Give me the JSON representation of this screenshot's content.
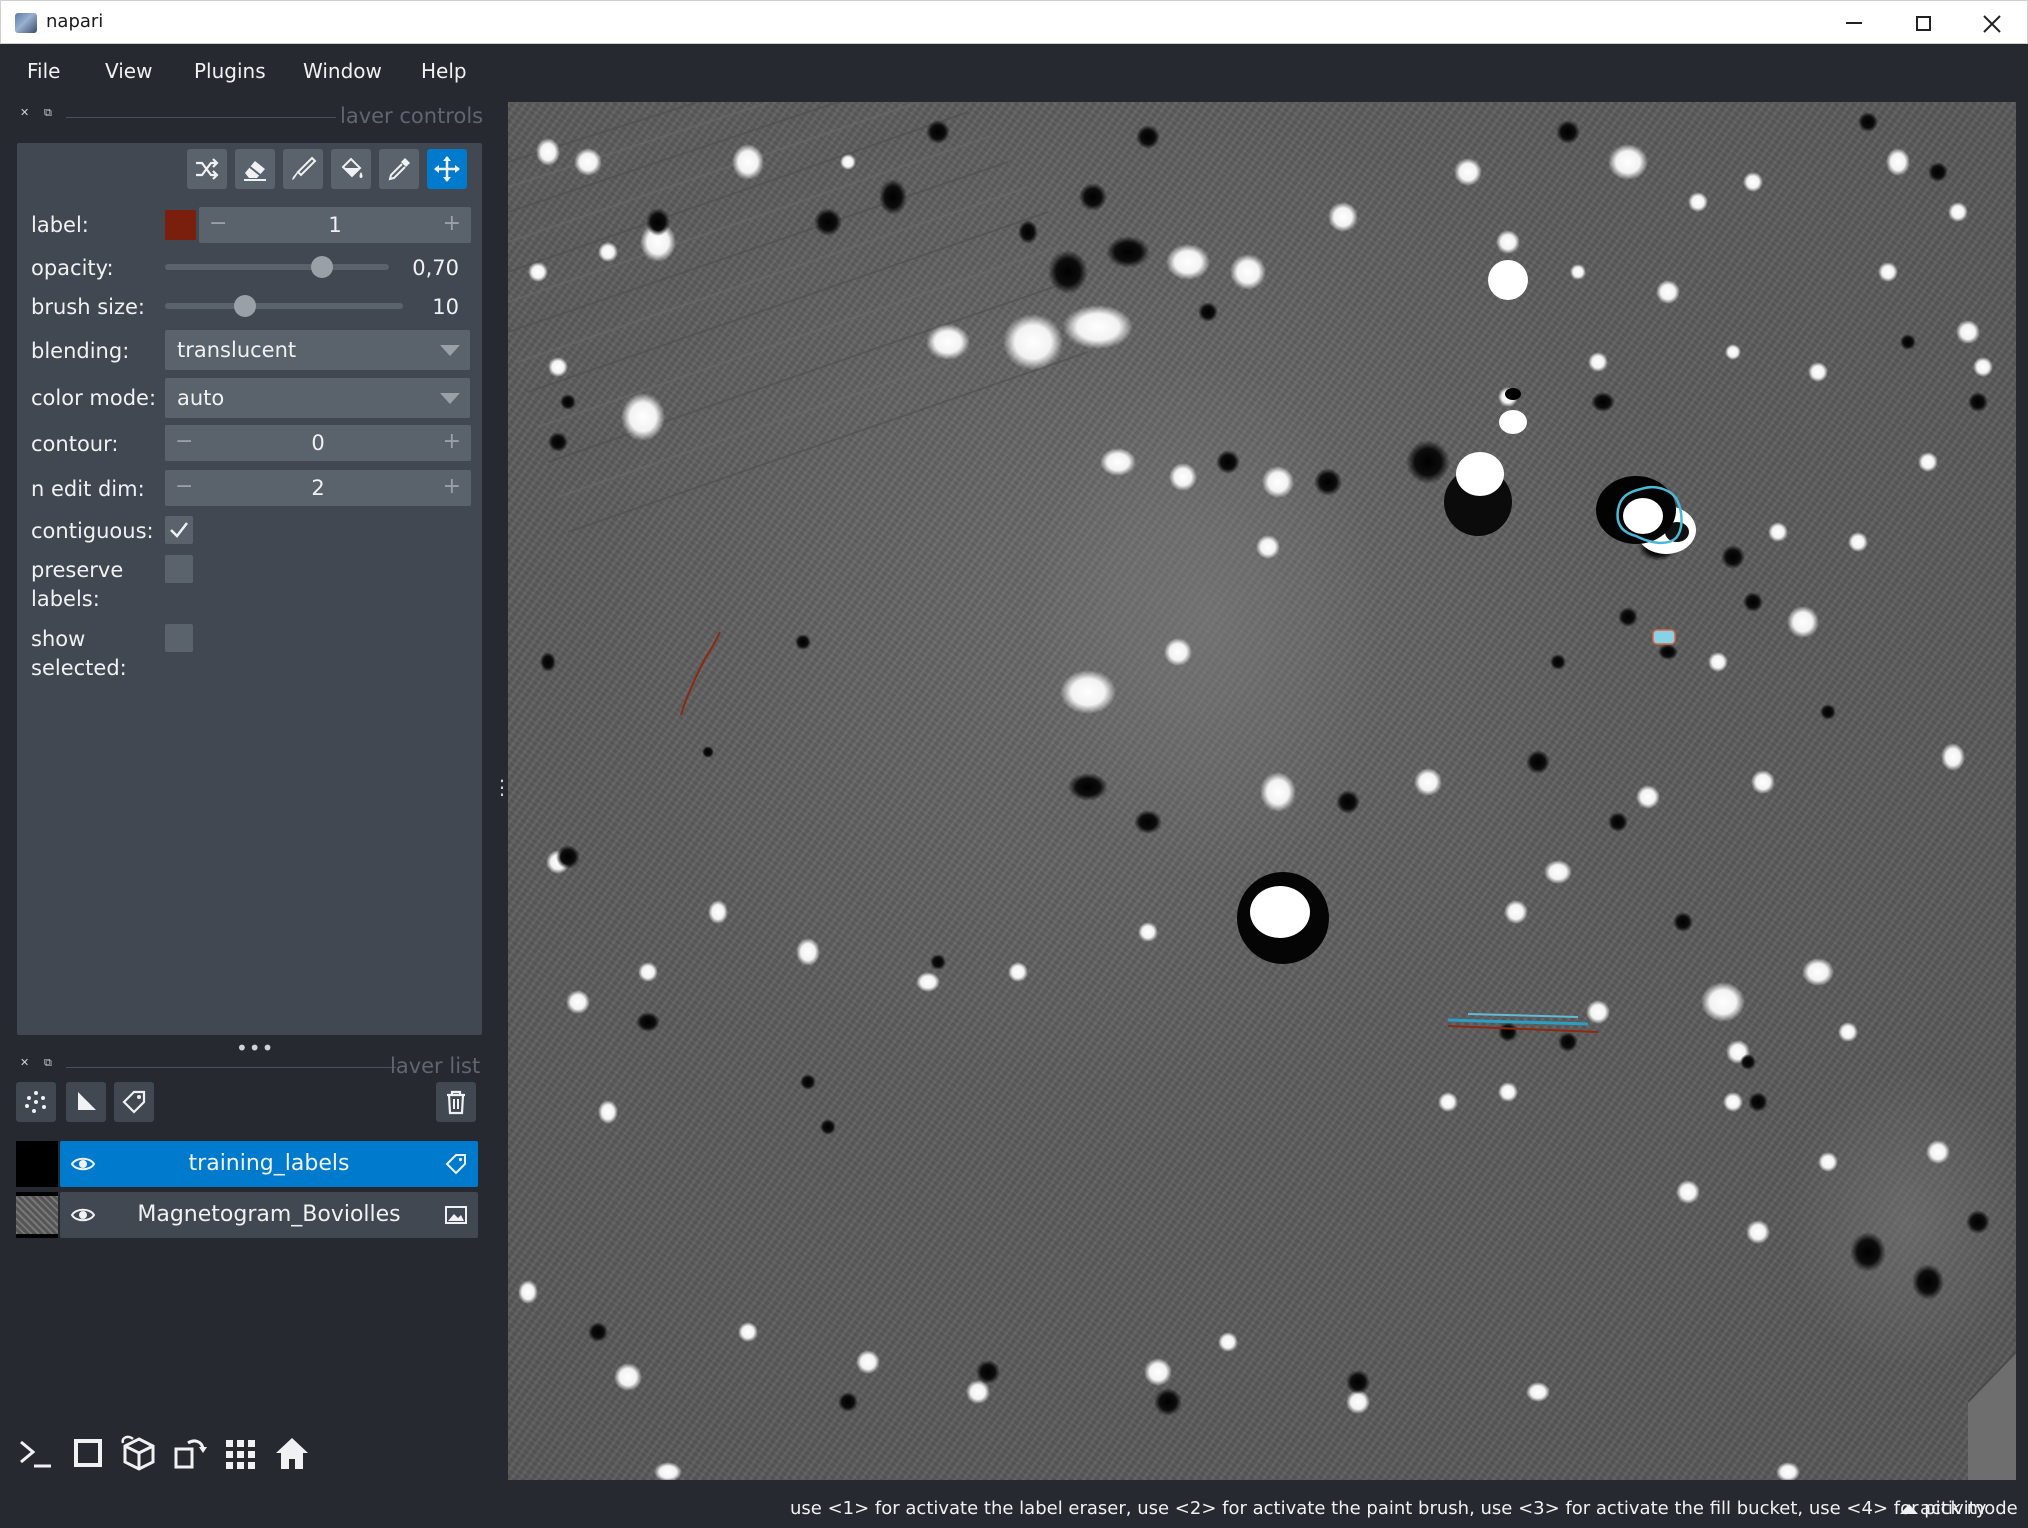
{
  "window": {
    "title": "napari"
  },
  "menu": [
    "File",
    "View",
    "Plugins",
    "Window",
    "Help"
  ],
  "layer_controls": {
    "title": "laver controls",
    "label": {
      "label": "label:",
      "value": "1",
      "color": "#7a1f0e"
    },
    "opacity": {
      "label": "opacity:",
      "value": "0,70",
      "fraction": 0.7
    },
    "brush_size": {
      "label": "brush size:",
      "value": "10",
      "fraction": 0.25
    },
    "blending": {
      "label": "blending:",
      "value": "translucent"
    },
    "color_mode": {
      "label": "color mode:",
      "value": "auto"
    },
    "contour": {
      "label": "contour:",
      "value": "0"
    },
    "n_edit_dim": {
      "label": "n edit dim:",
      "value": "2"
    },
    "contiguous": {
      "label": "contiguous:",
      "checked": true
    },
    "preserve_labels": {
      "label_line1": "preserve",
      "label_line2": "labels:",
      "checked": false
    },
    "show_selected": {
      "label_line1": "show",
      "label_line2": "selected:",
      "checked": false
    },
    "tools": [
      "shuffle-icon",
      "eraser-icon",
      "paintbrush-icon",
      "fill-bucket-icon",
      "picker-icon",
      "pan-zoom-icon"
    ],
    "active_tool": "pan-zoom-icon"
  },
  "layer_list": {
    "title": "laver list",
    "layers": [
      {
        "name": "training_labels",
        "selected": true,
        "type_icon": "labels-icon"
      },
      {
        "name": "Magnetogram_Boviolles",
        "selected": false,
        "type_icon": "image-icon"
      }
    ]
  },
  "accent_color": "#007acc",
  "status": {
    "message": "use <1> for activate the label eraser, use <2> for activate the paint brush, use <3> for activate the fill bucket, use <4> for pick mode",
    "activity": "activity"
  }
}
